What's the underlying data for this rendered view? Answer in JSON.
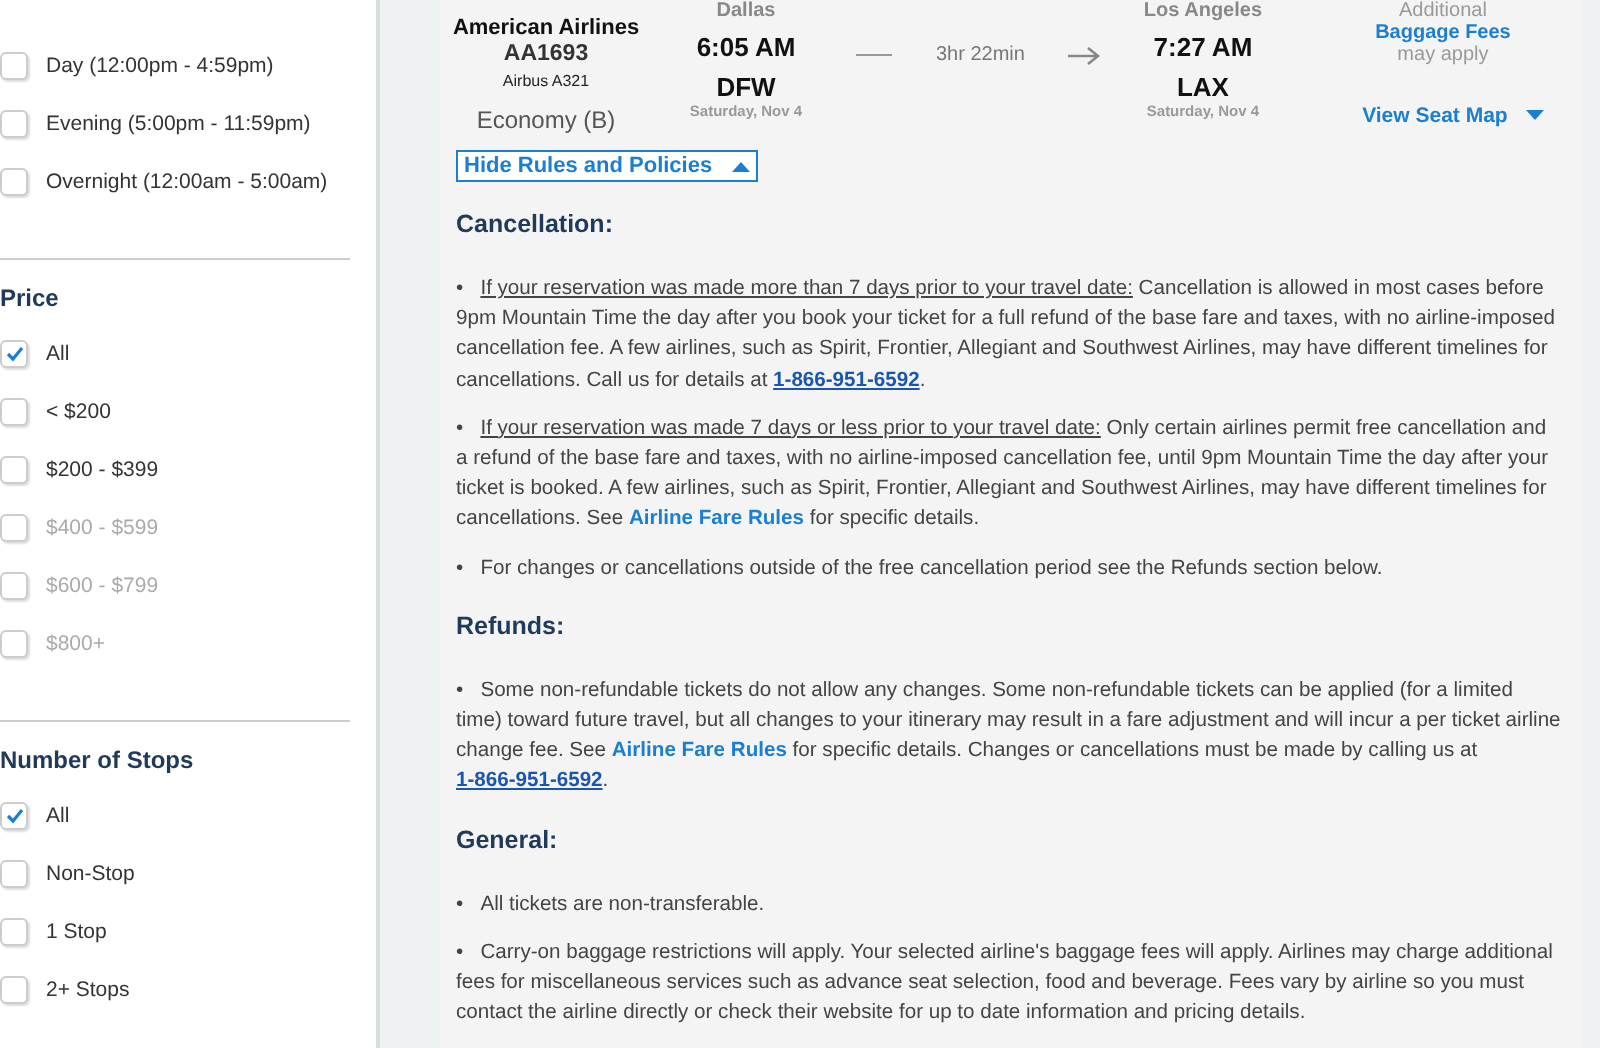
{
  "filters": [
    {
      "options": [
        {
          "label": "Day (12:00pm - 4:59pm)",
          "checked": false,
          "disabled": false
        },
        {
          "label": "Evening (5:00pm - 11:59pm)",
          "checked": false,
          "disabled": false
        },
        {
          "label": "Overnight (12:00am - 5:00am)",
          "checked": false,
          "disabled": false
        }
      ]
    },
    {
      "title": "Price",
      "options": [
        {
          "label": "All",
          "checked": true,
          "disabled": false
        },
        {
          "label": "< $200",
          "checked": false,
          "disabled": false
        },
        {
          "label": "$200 - $399",
          "checked": false,
          "disabled": false
        },
        {
          "label": "$400 - $599",
          "checked": false,
          "disabled": true
        },
        {
          "label": "$600 - $799",
          "checked": false,
          "disabled": true
        },
        {
          "label": "$800+",
          "checked": false,
          "disabled": true
        }
      ]
    },
    {
      "title": "Number of Stops",
      "options": [
        {
          "label": "All",
          "checked": true,
          "disabled": false
        },
        {
          "label": "Non-Stop",
          "checked": false,
          "disabled": false
        },
        {
          "label": "1 Stop",
          "checked": false,
          "disabled": false
        },
        {
          "label": "2+ Stops",
          "checked": false,
          "disabled": false
        }
      ]
    }
  ],
  "flight": {
    "airline": "American Airlines",
    "number": "AA1693",
    "aircraft": "Airbus A321",
    "cabin": "Economy (B)",
    "depart": {
      "city": "Dallas",
      "time": "6:05 AM",
      "code": "DFW",
      "date": "Saturday, Nov 4"
    },
    "duration": "3hr 22min",
    "arrive": {
      "city": "Los Angeles",
      "time": "7:27 AM",
      "code": "LAX",
      "date": "Saturday, Nov 4"
    },
    "baggage": {
      "before": "Additional",
      "link": "Baggage Fees",
      "after": "may apply"
    },
    "seat_map": "View Seat Map"
  },
  "rules_toggle": {
    "label": "Hide Rules and Policies",
    "expanded": true
  },
  "sections": [
    {
      "heading": "Cancellation:",
      "bullets": [
        [
          {
            "kind": "bullet",
            "text": "•"
          },
          {
            "kind": "lead",
            "text": "If your reservation was made more than 7 days prior to your travel date:"
          },
          {
            "kind": "text",
            "text": " Cancellation is allowed in most cases before 9pm Mountain Time the day after you book your ticket for a full refund of the base fare and taxes, with no airline-imposed cancellation fee. A few airlines, such as Spirit, Frontier, Allegiant and Southwest Airlines, may have different timelines for cancellations. Call us for details at "
          },
          {
            "kind": "phone",
            "text": "1-866-951-6592"
          },
          {
            "kind": "text",
            "text": "."
          }
        ],
        [
          {
            "kind": "bullet",
            "text": "•"
          },
          {
            "kind": "lead",
            "text": "If your reservation was made 7 days or less prior to your travel date:"
          },
          {
            "kind": "text",
            "text": " Only certain airlines permit free cancellation and a refund of the base fare and taxes, with no airline-imposed cancellation fee, until 9pm Mountain Time the day after your ticket is booked. A few airlines, such as Spirit, Frontier, Allegiant and Southwest Airlines, may have different timelines for cancellations. See "
          },
          {
            "kind": "link",
            "text": "Airline Fare Rules"
          },
          {
            "kind": "text",
            "text": " for specific details."
          }
        ],
        [
          {
            "kind": "bullet",
            "text": "•"
          },
          {
            "kind": "text",
            "text": "For changes or cancellations outside of the free cancellation period see the Refunds section below."
          }
        ]
      ]
    },
    {
      "heading": "Refunds:",
      "bullets": [
        [
          {
            "kind": "bullet",
            "text": "•"
          },
          {
            "kind": "text",
            "text": "Some non-refundable tickets do not allow any changes. Some non-refundable tickets can be applied (for a limited time) toward future travel, but all changes to your itinerary may result in a fare adjustment and will incur a per ticket airline change fee. See "
          },
          {
            "kind": "link",
            "text": "Airline Fare Rules"
          },
          {
            "kind": "text",
            "text": " for specific details. Changes or cancellations must be made by calling us at "
          },
          {
            "kind": "phone",
            "text": "1-866-951-6592"
          },
          {
            "kind": "text",
            "text": "."
          }
        ]
      ]
    },
    {
      "heading": "General:",
      "bullets": [
        [
          {
            "kind": "bullet",
            "text": "•"
          },
          {
            "kind": "text",
            "text": "All tickets are non-transferable."
          }
        ],
        [
          {
            "kind": "bullet",
            "text": "•"
          },
          {
            "kind": "text",
            "text": "Carry-on baggage restrictions will apply. Your selected airline's baggage fees will apply. Airlines may charge additional fees for miscellaneous services such as advance seat selection, food and beverage. Fees vary by airline so you must contact the airline directly or check their website for up to date information and pricing details."
          }
        ]
      ]
    }
  ]
}
